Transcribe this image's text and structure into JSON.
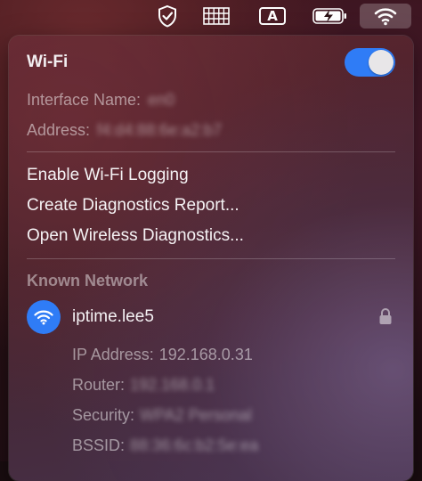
{
  "menubar": {
    "icons": [
      "shield-check-icon",
      "keyboard-grid-icon",
      "input-source-icon",
      "battery-charging-icon",
      "wifi-icon"
    ],
    "input_source_letter": "A"
  },
  "wifi_panel": {
    "title": "Wi-Fi",
    "toggle_on": true,
    "interface_label": "Interface Name:",
    "interface_value": "en0",
    "address_label": "Address:",
    "address_value": "f4:d4:88:6e:a2:b7",
    "menu_items": [
      "Enable Wi-Fi Logging",
      "Create Diagnostics Report...",
      "Open Wireless Diagnostics..."
    ],
    "known_network_header": "Known Network",
    "network": {
      "name": "iptime.lee5",
      "ip_label": "IP Address:",
      "ip_value": "192.168.0.31",
      "router_label": "Router:",
      "router_value": "192.168.0.1",
      "security_label": "Security:",
      "security_value": "WPA2 Personal",
      "bssid_label": "BSSID:",
      "bssid_value": "88:36:6c:b2:5e:ea"
    }
  },
  "colors": {
    "accent": "#2f7cf6",
    "toggle_knob": "#e8e6e8"
  }
}
